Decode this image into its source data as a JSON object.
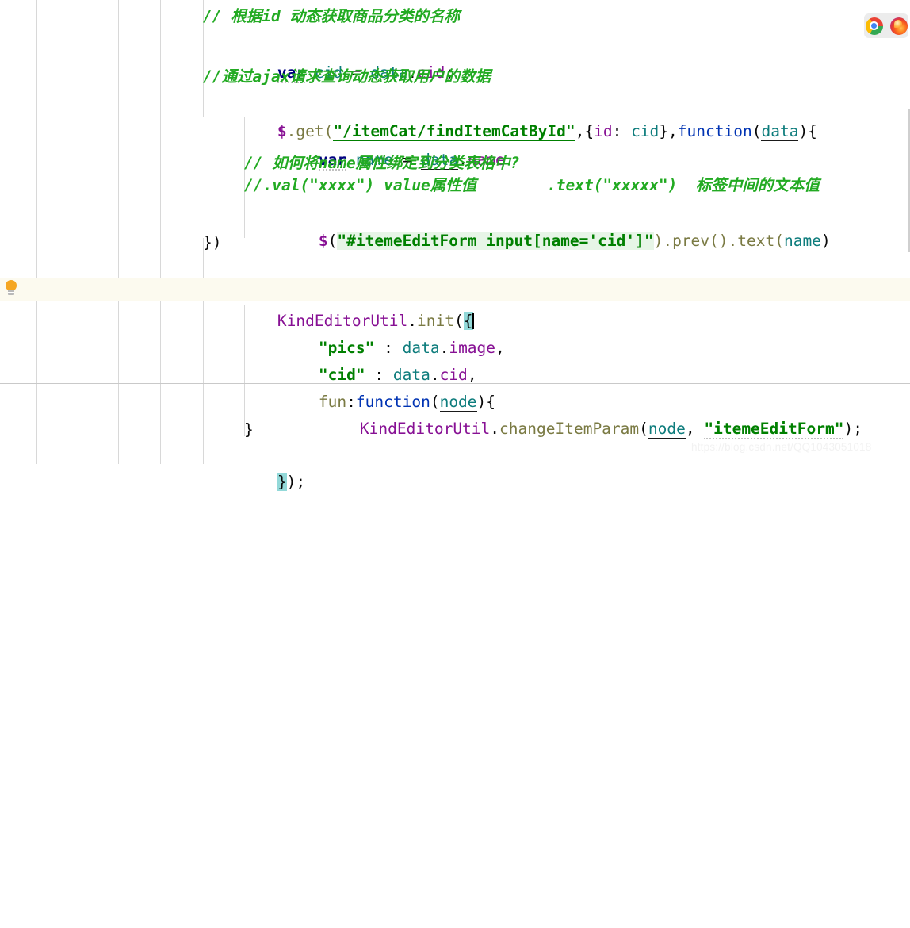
{
  "app": {
    "name": "IntelliJ IDEA Code Editor",
    "file_type": "JavaScript"
  },
  "editor": {
    "font_size_px": 19.5,
    "line_height_px": 33,
    "background": "#ffffff",
    "current_line_highlight": "#fcfaef",
    "gutter_rule_color": "#d8d8d8",
    "fold_rule_color": "#c9c9c9"
  },
  "colors": {
    "comment": "#22aa22",
    "keyword": "#000080",
    "string": "#008000",
    "field": "#871094",
    "local_var": "#0d7c7c",
    "function_name": "#7a7a43",
    "function_keyword": "#0033b3",
    "plain": "#080808",
    "selection_string_bg": "#e7f5e7",
    "bracket_match_bg": "#93d9d9",
    "watermark": "#f2f2f2"
  },
  "gutter": {
    "intention_bulb": {
      "icon": "lightbulb-icon",
      "tooltip": "Show intention actions",
      "line_index": 9
    }
  },
  "toolbar": {
    "browsers": [
      {
        "icon": "chrome-icon",
        "label": "Chrome"
      },
      {
        "icon": "firefox-icon",
        "label": "Firefox"
      }
    ]
  },
  "watermark": {
    "text": "https://blog.csdn.net/QQ1043051018"
  },
  "code": {
    "lines": [
      {
        "index": 0,
        "indent": 0,
        "plain": "// 根据id 动态获取商品分类的名称",
        "type": "comment"
      },
      {
        "index": 1,
        "indent": 0,
        "plain": "var cid = data.cid;",
        "type": "statement"
      },
      {
        "index": 2,
        "indent": 0,
        "plain": "//通过ajax请求查询动态获取用户的数据",
        "type": "comment"
      },
      {
        "index": 3,
        "indent": 0,
        "plain": "$.get(\"/itemCat/findItemCatById\",{id: cid},function(data){",
        "type": "statement"
      },
      {
        "index": 4,
        "indent": 1,
        "plain": "var name = data.name",
        "type": "statement"
      },
      {
        "index": 5,
        "indent": 1,
        "plain": "// 如何将name属性绑定到分类表格中?",
        "type": "comment"
      },
      {
        "index": 6,
        "indent": 1,
        "plain": "//.val(\"xxxx\") value属性值    .text(\"xxxxx\")  标签中间的文本值",
        "type": "comment"
      },
      {
        "index": 7,
        "indent": 1,
        "plain": "$(\"#itemeEditForm input[name='cid']\").prev().text(name)",
        "type": "statement"
      },
      {
        "index": 8,
        "indent": 0,
        "plain": "})",
        "type": "statement"
      },
      {
        "index": 9,
        "indent": 0,
        "plain": "",
        "type": "blank"
      },
      {
        "index": 10,
        "indent": 0,
        "plain": "KindEditorUtil.init({",
        "type": "statement",
        "current": true
      },
      {
        "index": 11,
        "indent": 1,
        "plain": "\"pics\" : data.image,",
        "type": "statement"
      },
      {
        "index": 12,
        "indent": 1,
        "plain": "\"cid\" : data.cid,",
        "type": "statement"
      },
      {
        "index": 13,
        "indent": 1,
        "plain": "fun:function(node){",
        "type": "statement"
      },
      {
        "index": 14,
        "indent": 2,
        "plain": "KindEditorUtil.changeItemParam(node, \"itemeEditForm\");",
        "type": "statement"
      },
      {
        "index": 15,
        "indent": 1,
        "plain": "}",
        "type": "statement"
      },
      {
        "index": 16,
        "indent": 0,
        "plain": "});",
        "type": "statement"
      }
    ],
    "tokens": {
      "l0_comment": "// 根据id 动态获取商品分类的名称",
      "l1_kw": "var",
      "l1_var": "cid",
      "l1_eq": " = ",
      "l1_obj": "data",
      "l1_dot": ".",
      "l1_prop": "cid",
      "l1_semi": ";",
      "l2_comment": "//通过ajax请求查询动态获取用户的数据",
      "l3_jq": "$",
      "l3_dotget": ".get(",
      "l3_url": "\"/itemCat/findItemCatById\"",
      "l3_comma": ",{",
      "l3_id": "id",
      "l3_colon": ": ",
      "l3_cid": "cid",
      "l3_close": "},",
      "l3_function": "function",
      "l3_paren": "(",
      "l3_data": "data",
      "l3_end": "){",
      "l4_kw": "var",
      "l4_name": "name",
      "l4_eq": " = ",
      "l4_data": "data",
      "l4_dot": ".",
      "l4_prop": "name",
      "l5_comment": "// 如何将name属性绑定到分类表格中?",
      "l6_comment_a": "//.val(\"xxxx\") value属性值",
      "l6_comment_b": ".text(\"xxxxx\")  标签中间的文本值",
      "l7_jq": "$",
      "l7_open": "(",
      "l7_sel": "\"#itemeEditForm input[name='cid']\"",
      "l7_tail": ").prev().text(",
      "l7_name": "name",
      "l7_close": ")",
      "l8": "})",
      "l10_cls": "KindEditorUtil",
      "l10_dot": ".",
      "l10_fn": "init",
      "l10_paren": "(",
      "l10_brace": "{",
      "l11_key": "\"pics\"",
      "l11_colon": " : ",
      "l11_obj": "data",
      "l11_dot": ".",
      "l11_prop": "image",
      "l11_comma": ",",
      "l12_key": "\"cid\"",
      "l12_colon": " : ",
      "l12_obj": "data",
      "l12_dot": ".",
      "l12_prop": "cid",
      "l12_comma": ",",
      "l13_key": "fun",
      "l13_colon": ":",
      "l13_function": "function",
      "l13_paren": "(",
      "l13_node": "node",
      "l13_end": "){",
      "l14_cls": "KindEditorUtil",
      "l14_dot": ".",
      "l14_fn": "changeItemParam",
      "l14_paren": "(",
      "l14_node": "node",
      "l14_comma": ", ",
      "l14_str": "\"itemeEditForm\"",
      "l14_end": ");",
      "l15": "}",
      "l16_brace": "}",
      "l16_tail": ");"
    }
  }
}
